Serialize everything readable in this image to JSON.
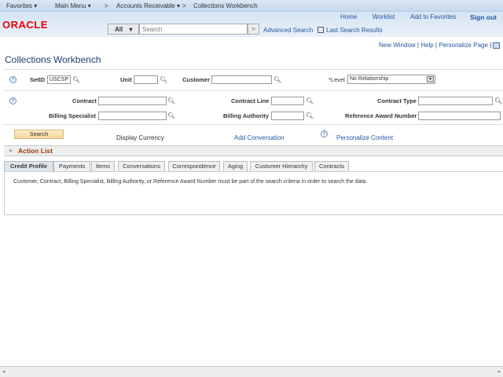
{
  "nav": {
    "favorites": "Favorites",
    "main_menu": "Main Menu",
    "accounts_receivable": "Accounts Receivable",
    "current": "Collections Workbench",
    "sep": ">"
  },
  "header": {
    "logo": "ORACLE",
    "home": "Home",
    "worklist": "Worklist",
    "add_favorites": "Add to Favorites",
    "sign_out": "Sign out",
    "search_scope": "All",
    "search_placeholder": "Search",
    "advanced_search": "Advanced Search",
    "last_results": "Last Search Results"
  },
  "pagebar": {
    "new_window": "New Window",
    "help": "Help",
    "personalize": "Personalize Page"
  },
  "page_title": "Collections Workbench",
  "form": {
    "setid_label": "SetID",
    "setid_value": "USCSP",
    "unit_label": "Unit",
    "customer_label": "Customer",
    "level_label": "*Level",
    "level_value": "No Relationship",
    "contract_label": "Contract",
    "contract_line_label": "Contract Line",
    "contract_type_label": "Contract Type",
    "billing_specialist_label": "Billing Specialist",
    "billing_authority_label": "Billing Authority",
    "ref_award_label": "Reference Award Number"
  },
  "actions": {
    "search": "Search",
    "display_currency": "Display Currency",
    "add_conversation": "Add Conversation",
    "personalize_content": "Personalize Content"
  },
  "action_list": "Action List",
  "tabs": [
    "Credit Profile",
    "Payments",
    "Items",
    "Conversations",
    "Correspondence",
    "Aging",
    "Customer Hierarchy",
    "Contracts"
  ],
  "message": "Customer, Contract, Billing Specialist, Billing Authority,  or Reference Award Number must be part of the search criteria in order to search the data.",
  "colors": {
    "brand": "#e00",
    "link": "#2456a0",
    "title": "#1d3f6e",
    "action_list": "#9a3a00"
  }
}
